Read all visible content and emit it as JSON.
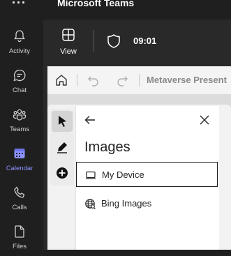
{
  "app": {
    "title": "Microsoft Teams"
  },
  "rail": {
    "items": [
      {
        "label": "Activity",
        "icon": "bell-icon"
      },
      {
        "label": "Chat",
        "icon": "chat-icon"
      },
      {
        "label": "Teams",
        "icon": "teams-icon"
      },
      {
        "label": "Calendar",
        "icon": "calendar-icon",
        "active": true
      },
      {
        "label": "Calls",
        "icon": "phone-icon"
      },
      {
        "label": "Files",
        "icon": "file-icon"
      }
    ]
  },
  "meeting_toolbar": {
    "view_label": "View",
    "time": "09:01"
  },
  "presentation": {
    "title": "Metaverse Present"
  },
  "images_panel": {
    "heading": "Images",
    "options": [
      {
        "label": "My Device",
        "icon": "device-icon"
      },
      {
        "label": "Bing Images",
        "icon": "globe-icon"
      }
    ]
  },
  "colors": {
    "accent": "#8c93ff",
    "rail_bg": "#1f1f1f",
    "panel_bg": "#ffffff"
  }
}
